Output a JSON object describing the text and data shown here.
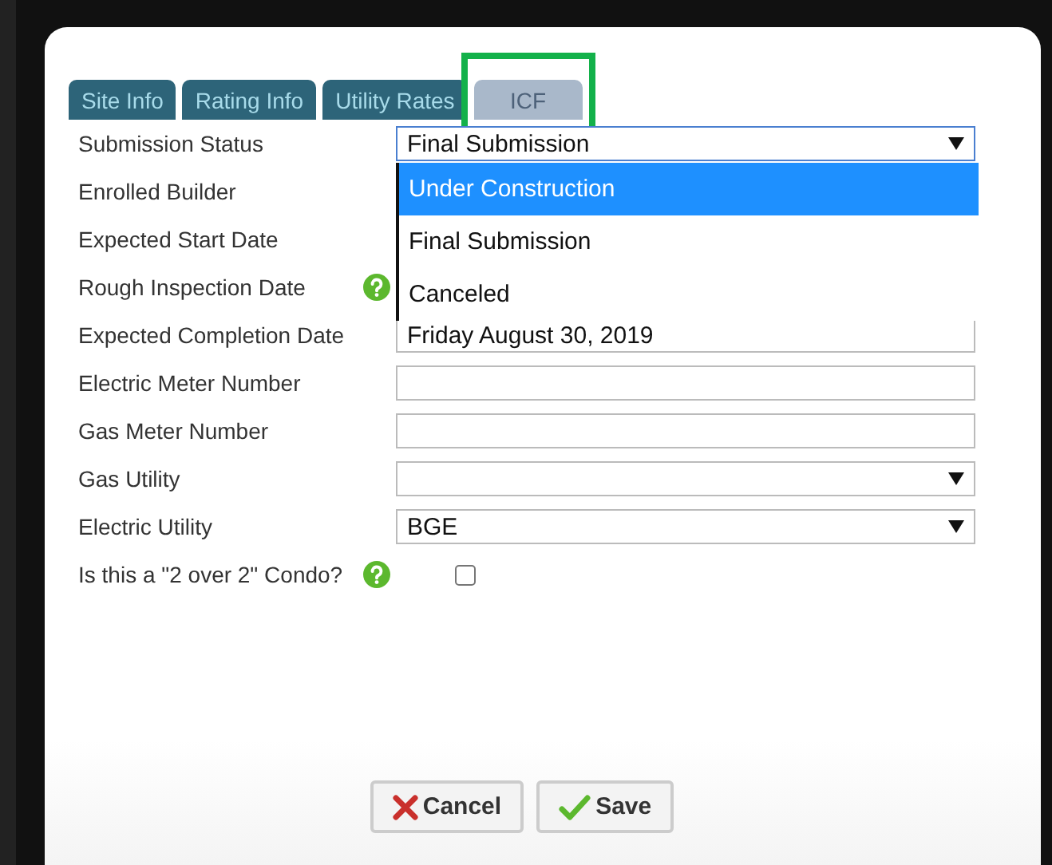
{
  "tabs": [
    {
      "label": "Site Info",
      "selected": false,
      "highlighted": false
    },
    {
      "label": "Rating Info",
      "selected": false,
      "highlighted": false
    },
    {
      "label": "Utility Rates",
      "selected": false,
      "highlighted": false
    },
    {
      "label": "ICF",
      "selected": true,
      "highlighted": true
    }
  ],
  "fields": [
    {
      "label": "Submission Status",
      "kind": "select",
      "value": "Final Submission",
      "help": false,
      "open": true
    },
    {
      "label": "Enrolled Builder",
      "kind": "covered",
      "help": false
    },
    {
      "label": "Expected Start Date",
      "kind": "covered",
      "help": false
    },
    {
      "label": "Rough Inspection Date",
      "kind": "covered",
      "help": true
    },
    {
      "label": "Expected Completion Date",
      "kind": "text",
      "value": "Friday August 30, 2019",
      "help": false
    },
    {
      "label": "Electric Meter Number",
      "kind": "text",
      "help": false
    },
    {
      "label": "Gas Meter Number",
      "kind": "text",
      "help": false
    },
    {
      "label": "Gas Utility",
      "kind": "select",
      "help": false
    },
    {
      "label": "Electric Utility",
      "kind": "select",
      "value": "BGE",
      "help": false
    },
    {
      "label": "Is this a \"2 over 2\" Condo?",
      "kind": "checkbox",
      "checked": false,
      "help": true
    }
  ],
  "dropdown": {
    "options": [
      {
        "label": "Under Construction",
        "selected": true
      },
      {
        "label": "Final Submission",
        "selected": false
      },
      {
        "label": "Canceled",
        "selected": false
      }
    ]
  },
  "buttons": [
    {
      "label": "Cancel",
      "kind": "cancel"
    },
    {
      "label": "Save",
      "kind": "save"
    }
  ]
}
